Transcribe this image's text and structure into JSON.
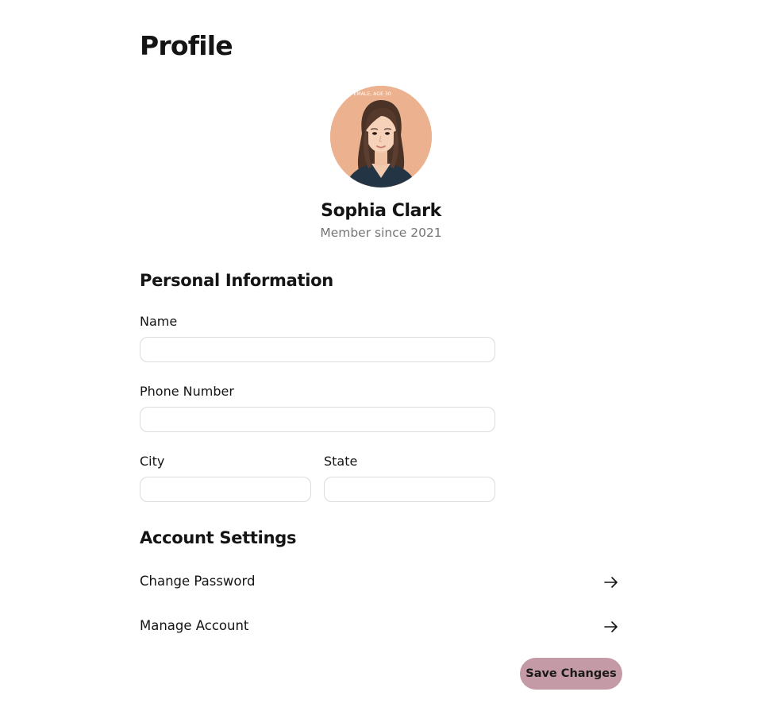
{
  "header": {
    "title": "Profile"
  },
  "profile": {
    "avatar_caption": "FEMALE, AGE 30",
    "name": "Sophia Clark",
    "member_since": "Member since 2021"
  },
  "personal_info": {
    "title": "Personal Information",
    "name_label": "Name",
    "name_value": "",
    "phone_label": "Phone Number",
    "phone_value": "",
    "city_label": "City",
    "city_value": "",
    "state_label": "State",
    "state_value": ""
  },
  "account_settings": {
    "title": "Account Settings",
    "items": [
      {
        "label": "Change Password",
        "icon": "arrow-right-icon"
      },
      {
        "label": "Manage Account",
        "icon": "arrow-right-icon"
      }
    ]
  },
  "actions": {
    "save_label": "Save Changes"
  },
  "colors": {
    "accent_button": "#c49aa6",
    "avatar_background": "#ecb290",
    "muted_text": "#757575",
    "input_border": "#dcdcdc"
  }
}
